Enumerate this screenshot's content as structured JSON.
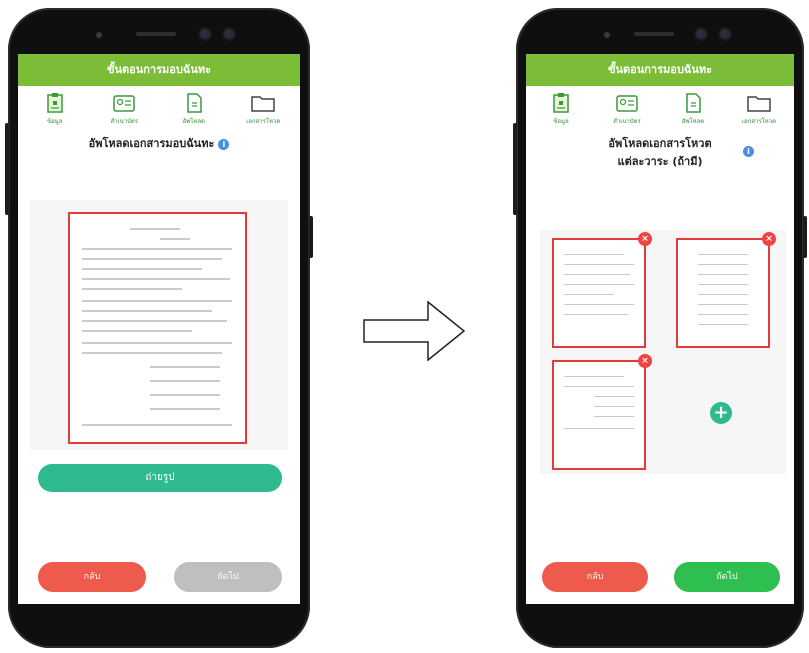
{
  "left_phone": {
    "header_title": "ขั้นตอนการมอบฉันทะ",
    "steps": [
      {
        "label": "ข้อมูล",
        "icon": "clipboard-icon"
      },
      {
        "label": "สำเนาบัตร",
        "icon": "id-card-icon"
      },
      {
        "label": "อัพโหลด",
        "icon": "document-icon"
      },
      {
        "label": "เอกสารโหวต",
        "icon": "folder-icon"
      }
    ],
    "page_title": "อัพโหลดเอกสารมอบฉันทะ",
    "cta_label": "ถ่ายรูป",
    "back_label": "กลับ",
    "next_label": "ถัดไป"
  },
  "right_phone": {
    "header_title": "ขั้นตอนการมอบฉันทะ",
    "steps": [
      {
        "label": "ข้อมูล",
        "icon": "clipboard-icon"
      },
      {
        "label": "สำเนาบัตร",
        "icon": "id-card-icon"
      },
      {
        "label": "อัพโหลด",
        "icon": "document-icon"
      },
      {
        "label": "เอกสารโหวต",
        "icon": "folder-icon"
      }
    ],
    "page_title_line1": "อัพโหลดเอกสารโหวต",
    "page_title_line2": "แต่ละวาระ (ถ้ามี)",
    "back_label": "กลับ",
    "next_label": "ถัดไป"
  },
  "colors": {
    "header_green": "#7cbd37",
    "step_label_green": "#2f8f3a",
    "cta_teal": "#2fb98f",
    "back_red": "#ee5a4c",
    "next_disabled_gray": "#bfbfbf",
    "next_enabled_green": "#2fbf50",
    "frame_red": "#e23b3b",
    "info_blue": "#4a90e2"
  }
}
